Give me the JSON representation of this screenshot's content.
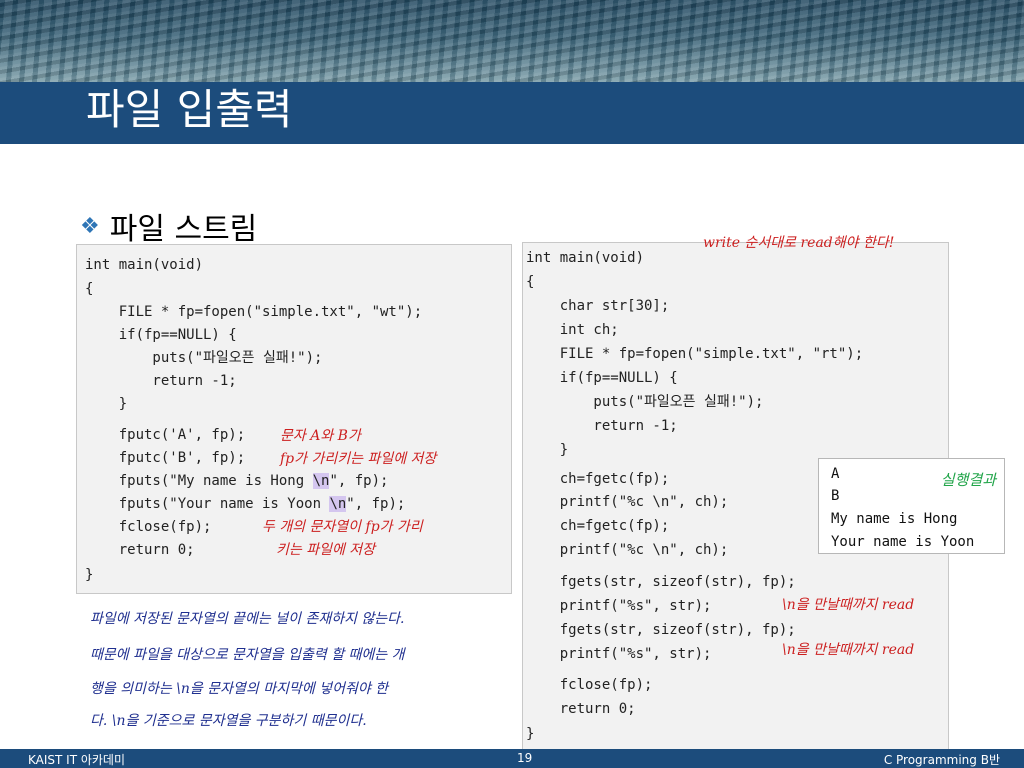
{
  "slide": {
    "title": "파일 입출력",
    "bullet": "파일 스트림"
  },
  "code_left": [
    {
      "t": "int main(void)"
    },
    {
      "t": "{"
    },
    {
      "t": "    FILE * fp=fopen(\"simple.txt\", \"wt\");"
    },
    {
      "t": "    if(fp==NULL) {"
    },
    {
      "t": "        puts(\"파일오픈 실패!\");"
    },
    {
      "t": "        return -1;"
    },
    {
      "t": "    }"
    },
    {
      "t": "    fputc('A', fp);"
    },
    {
      "t": "    fputc('B', fp);"
    },
    {
      "t": "    fputs(\"My name is Hong ",
      "h": "\\n",
      "a": "\", fp);"
    },
    {
      "t": "    fputs(\"Your name is Yoon ",
      "h": "\\n",
      "a": "\", fp);"
    },
    {
      "t": "    fclose(fp);"
    },
    {
      "t": "    return 0;"
    },
    {
      "t": "}"
    }
  ],
  "code_right": [
    "int main(void)",
    "{",
    "    char str[30];",
    "    int ch;",
    "    FILE * fp=fopen(\"simple.txt\", \"rt\");",
    "    if(fp==NULL) {",
    "        puts(\"파일오픈 실패!\");",
    "        return -1;",
    "    }",
    "    ch=fgetc(fp);",
    "    printf(\"%c \\n\", ch);",
    "    ch=fgetc(fp);",
    "    printf(\"%c \\n\", ch);",
    "    fgets(str, sizeof(str), fp);",
    "    printf(\"%s\", str);",
    "    fgets(str, sizeof(str), fp);",
    "    printf(\"%s\", str);",
    "    fclose(fp);",
    "    return 0;",
    "}"
  ],
  "annotations": {
    "write_read": "write 순서대로 read해야 한다!",
    "char_ab": "문자 A와 B가",
    "fp_points": "fp가 가리키는 파일에 저장",
    "two_strings_1": "두 개의 문자열이 fp가 가리",
    "two_strings_2": "키는 파일에 저장",
    "read_until_1": "\\n을 만날때까지 read",
    "read_until_2": "\\n을 만날때까지 read"
  },
  "output": {
    "label": "실행결과",
    "lines": [
      "A",
      "B",
      "My name is Hong",
      "Your name is Yoon"
    ]
  },
  "explanation": [
    "파일에 저장된 문자열의 끝에는 널이 존재하지 않는다.",
    "때문에 파일을 대상으로 문자열을 입출력 할 때에는 개",
    "행을 의미하는  \\n을 문자열의 마지막에 넣어줘야 한",
    "다. \\n을 기준으로 문자열을 구분하기 때문이다."
  ],
  "footer": {
    "left": "KAIST IT 아카데미",
    "page": "19",
    "right": "C Programming B반"
  },
  "icons": {
    "bullet": "diamond-bullet-icon"
  },
  "colors": {
    "title_bar": "#1c4c7c",
    "annotation": "#cc1f1f",
    "result_label": "#22a54a",
    "explanation": "#1f2f8f",
    "highlight": "#d4c6ef"
  }
}
